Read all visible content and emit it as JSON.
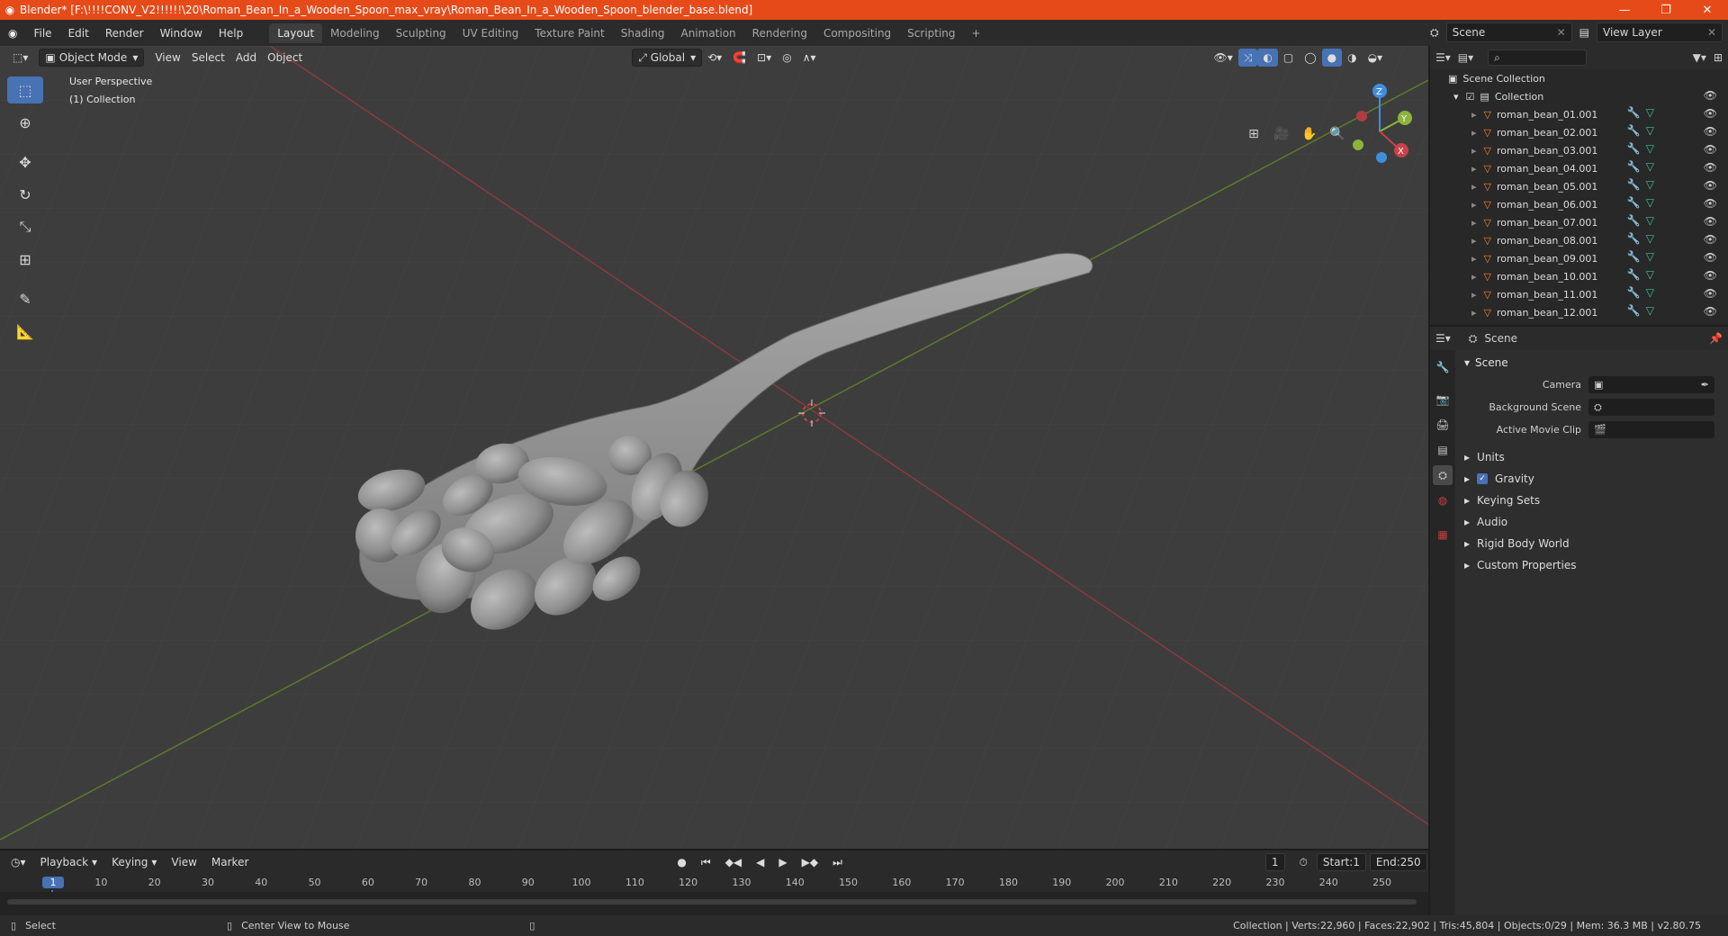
{
  "window": {
    "title": "Blender* [F:\\!!!!CONV_V2!!!!!!\\20\\Roman_Bean_In_a_Wooden_Spoon_max_vray\\Roman_Bean_In_a_Wooden_Spoon_blender_base.blend]",
    "minimize": "—",
    "maximize": "❐",
    "close": "✕"
  },
  "menu": [
    "File",
    "Edit",
    "Render",
    "Window",
    "Help"
  ],
  "workspaces": [
    "Layout",
    "Modeling",
    "Sculpting",
    "UV Editing",
    "Texture Paint",
    "Shading",
    "Animation",
    "Rendering",
    "Compositing",
    "Scripting",
    "+"
  ],
  "active_workspace": "Layout",
  "scene_selector": "Scene",
  "view_layer_selector": "View Layer",
  "viewport": {
    "mode": "Object Mode",
    "menus": [
      "View",
      "Select",
      "Add",
      "Object"
    ],
    "transform_orientation": "Global",
    "overlay_line1": "User Perspective",
    "overlay_line2": "(1) Collection",
    "gizmo": {
      "x": "X",
      "y": "Y",
      "z": "Z"
    }
  },
  "outliner": {
    "root": "Scene Collection",
    "collection": "Collection",
    "items": [
      "roman_bean_01.001",
      "roman_bean_02.001",
      "roman_bean_03.001",
      "roman_bean_04.001",
      "roman_bean_05.001",
      "roman_bean_06.001",
      "roman_bean_07.001",
      "roman_bean_08.001",
      "roman_bean_09.001",
      "roman_bean_10.001",
      "roman_bean_11.001",
      "roman_bean_12.001"
    ]
  },
  "properties": {
    "context": "Scene",
    "panel": "Scene",
    "camera_label": "Camera",
    "background_scene_label": "Background Scene",
    "active_clip_label": "Active Movie Clip",
    "subpanels": [
      "Units",
      "Gravity",
      "Keying Sets",
      "Audio",
      "Rigid Body World",
      "Custom Properties"
    ],
    "gravity_checked": true
  },
  "timeline": {
    "menus": [
      "Playback",
      "Keying",
      "View",
      "Marker"
    ],
    "current_frame": "1",
    "start_label": "Start:",
    "start": "1",
    "end_label": "End:",
    "end": "250",
    "ticks": [
      "1",
      "10",
      "20",
      "30",
      "40",
      "50",
      "60",
      "70",
      "80",
      "90",
      "100",
      "110",
      "120",
      "130",
      "140",
      "150",
      "160",
      "170",
      "180",
      "190",
      "200",
      "210",
      "220",
      "230",
      "240",
      "250"
    ]
  },
  "status": {
    "left1": "Select",
    "left2": "Center View to Mouse",
    "stats": "Collection | Verts:22,960 | Faces:22,902 | Tris:45,804 | Objects:0/29 | Mem: 36.3 MB | v2.80.75"
  },
  "colors": {
    "titlebar": "#e64a19",
    "accent": "#4772b3",
    "x_axis": "#c7424a",
    "y_axis": "#8cb43c",
    "z_axis": "#3f8ede"
  }
}
